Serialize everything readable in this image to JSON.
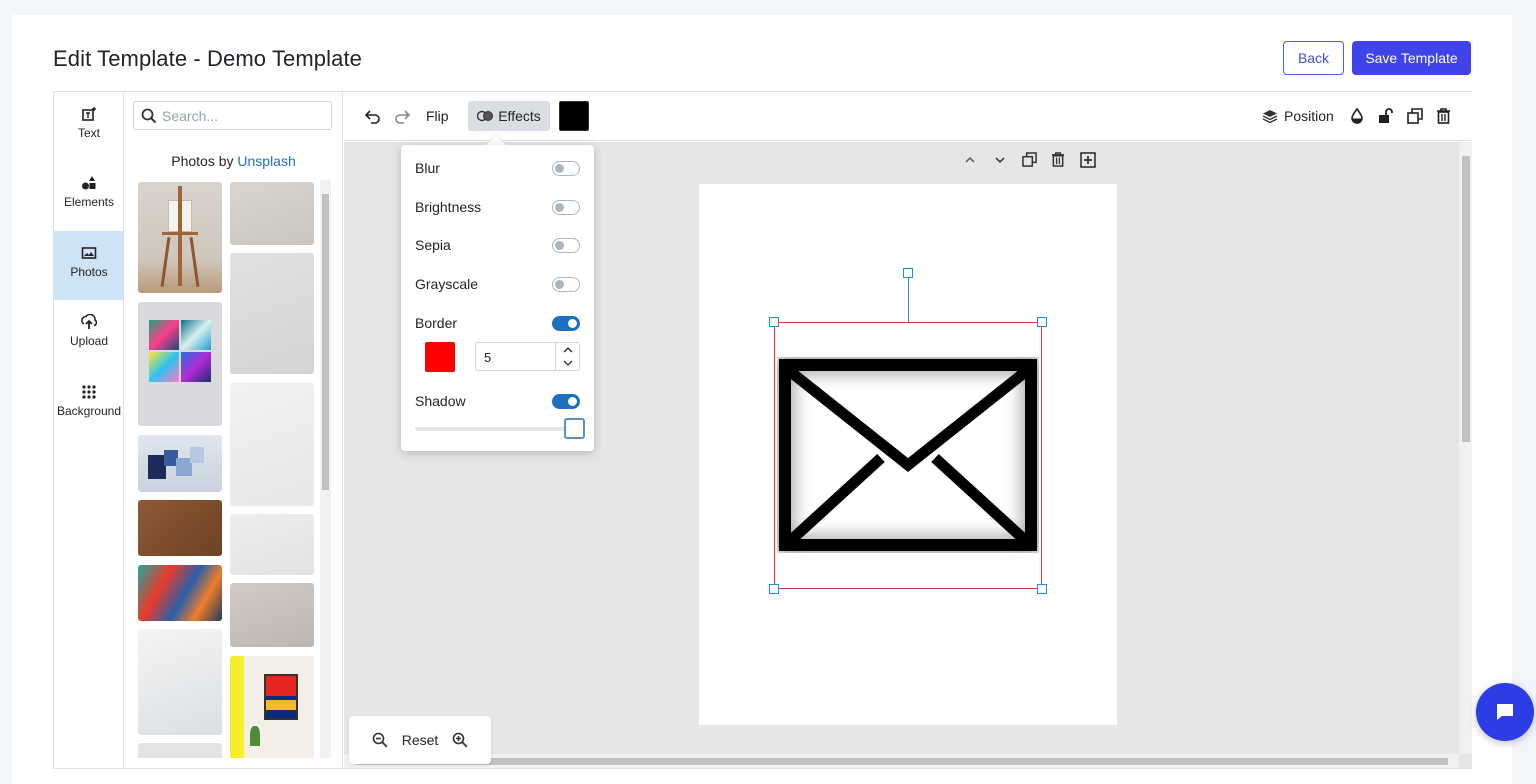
{
  "header": {
    "title": "Edit Template - Demo Template",
    "back_label": "Back",
    "save_label": "Save Template"
  },
  "tools": [
    {
      "label": "Text",
      "icon": "text-icon"
    },
    {
      "label": "Elements",
      "icon": "shapes-icon"
    },
    {
      "label": "Photos",
      "icon": "image-icon",
      "active": true
    },
    {
      "label": "Upload",
      "icon": "upload-icon"
    },
    {
      "label": "Background",
      "icon": "grid-dots-icon"
    }
  ],
  "photos_panel": {
    "search_placeholder": "Search...",
    "photos_by": "Photos by",
    "source_link": "Unsplash"
  },
  "toolbar": {
    "flip_label": "Flip",
    "effects_label": "Effects",
    "position_label": "Position",
    "fill_color": "#000000"
  },
  "effects": {
    "blur": {
      "label": "Blur",
      "on": false
    },
    "brightness": {
      "label": "Brightness",
      "on": false
    },
    "sepia": {
      "label": "Sepia",
      "on": false
    },
    "grayscale": {
      "label": "Grayscale",
      "on": false
    },
    "border": {
      "label": "Border",
      "on": true,
      "color": "#ff0000",
      "width": "5"
    },
    "shadow": {
      "label": "Shadow",
      "on": true,
      "level": 1.0
    }
  },
  "zoom": {
    "reset_label": "Reset"
  },
  "colors": {
    "accent": "#4043e9",
    "toggle_on": "#1d6fc0",
    "selection": "#1b8fe0"
  }
}
